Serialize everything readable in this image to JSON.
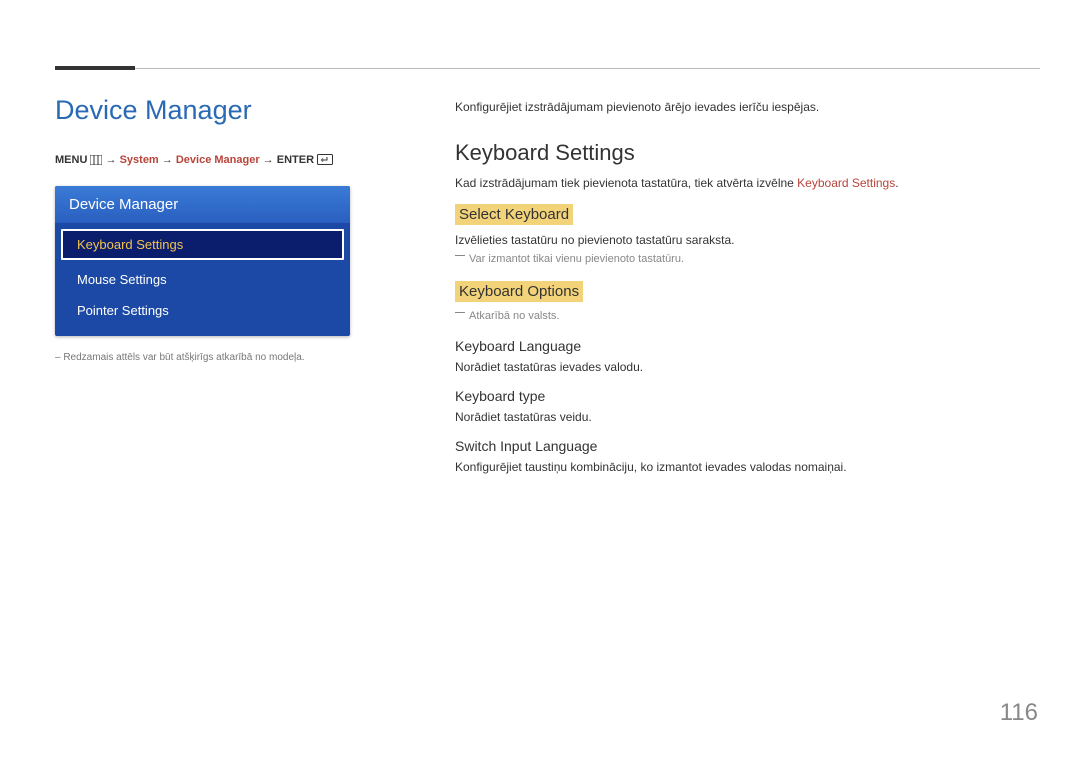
{
  "left": {
    "heading": "Device Manager",
    "breadcrumb": {
      "menu": "MENU",
      "system": "System",
      "device_manager": "Device Manager",
      "enter": "ENTER",
      "arrow": "→"
    },
    "panel": {
      "header": "Device Manager",
      "items": [
        {
          "label": "Keyboard Settings",
          "selected": true
        },
        {
          "label": "Mouse Settings",
          "selected": false
        },
        {
          "label": "Pointer Settings",
          "selected": false
        }
      ]
    },
    "footnote": "– Redzamais attēls var būt atšķirīgs atkarībā no modeļa."
  },
  "right": {
    "intro": "Konfigurējiet izstrādājumam pievienoto ārējo ievades ierīču iespējas.",
    "keyboard_settings": {
      "title": "Keyboard Settings",
      "desc_pre": "Kad izstrādājumam tiek pievienota tastatūra, tiek atvērta izvēlne ",
      "desc_red": "Keyboard Settings",
      "desc_post": "."
    },
    "select_keyboard": {
      "title": "Select Keyboard",
      "desc": "Izvēlieties tastatūru no pievienoto tastatūru saraksta.",
      "note": "Var izmantot tikai vienu pievienoto tastatūru."
    },
    "keyboard_options": {
      "title": "Keyboard Options",
      "note": "Atkarībā no valsts.",
      "items": [
        {
          "h": "Keyboard Language",
          "p": "Norādiet tastatūras ievades valodu."
        },
        {
          "h": "Keyboard type",
          "p": "Norādiet tastatūras veidu."
        },
        {
          "h": "Switch Input Language",
          "p": "Konfigurējiet taustiņu kombināciju, ko izmantot ievades valodas nomaiņai."
        }
      ]
    }
  },
  "page_number": "116"
}
